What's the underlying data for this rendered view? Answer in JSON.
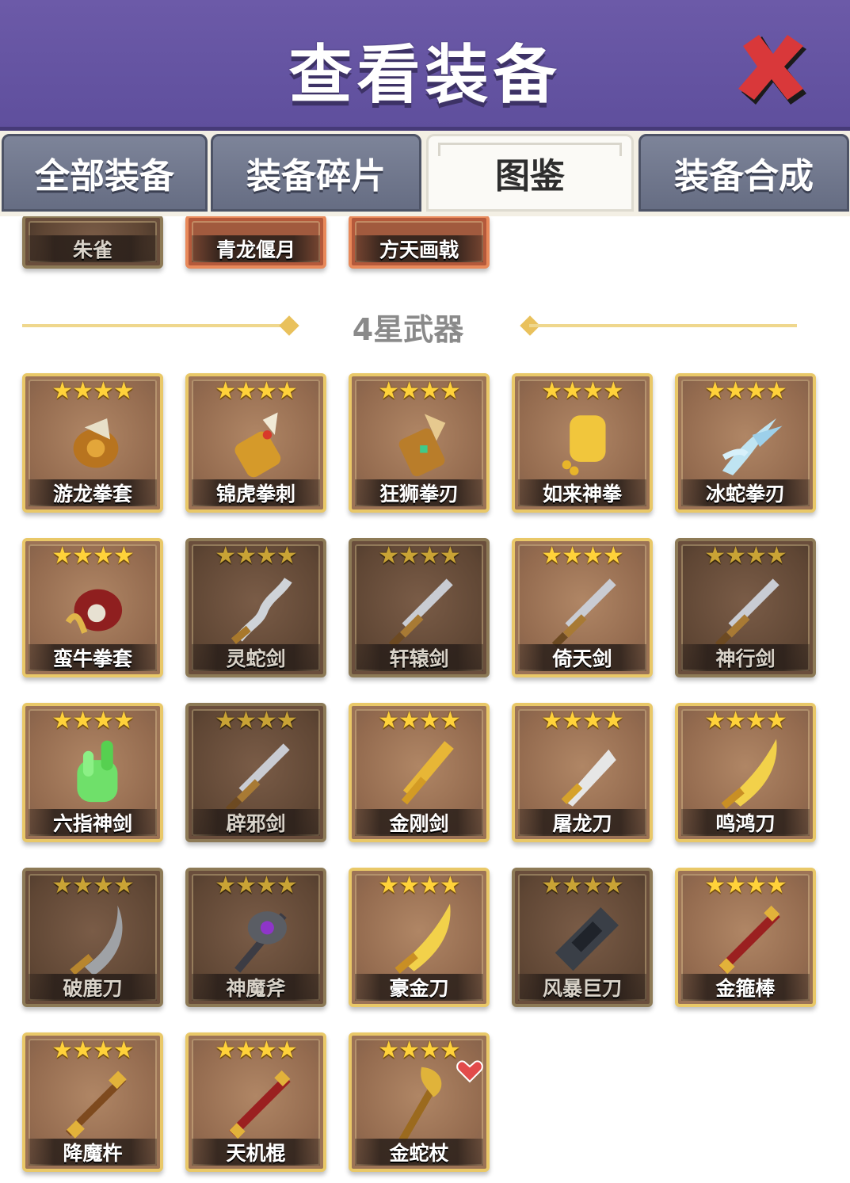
{
  "header": {
    "title": "查看装备",
    "close_icon": "close-x-icon"
  },
  "tabs": [
    {
      "label": "全部装备",
      "active": false
    },
    {
      "label": "装备碎片",
      "active": false
    },
    {
      "label": "图鉴",
      "active": true
    },
    {
      "label": "装备合成",
      "active": false
    }
  ],
  "top_row": [
    {
      "name": "朱雀"
    },
    {
      "name": "青龙偃月"
    },
    {
      "name": "方天画戟"
    }
  ],
  "section": {
    "title": "4星武器"
  },
  "stars_text": "★★★★",
  "items": [
    {
      "name": "游龙拳套",
      "icon": "gauntlet-icon",
      "owned": true
    },
    {
      "name": "锦虎拳刺",
      "icon": "claw-gauntlet-icon",
      "owned": true
    },
    {
      "name": "狂狮拳刃",
      "icon": "lion-gauntlet-icon",
      "owned": true
    },
    {
      "name": "如来神拳",
      "icon": "golden-fist-icon",
      "owned": true
    },
    {
      "name": "冰蛇拳刃",
      "icon": "ice-claw-icon",
      "owned": true
    },
    {
      "name": "蛮牛拳套",
      "icon": "bull-gauntlet-icon",
      "owned": true
    },
    {
      "name": "灵蛇剑",
      "icon": "serpent-sword-icon",
      "owned": false
    },
    {
      "name": "轩辕剑",
      "icon": "sword-icon",
      "owned": false
    },
    {
      "name": "倚天剑",
      "icon": "sword-icon",
      "owned": true
    },
    {
      "name": "神行剑",
      "icon": "sword-icon",
      "owned": false
    },
    {
      "name": "六指神剑",
      "icon": "jade-hand-icon",
      "owned": true
    },
    {
      "name": "辟邪剑",
      "icon": "sword-icon",
      "owned": false
    },
    {
      "name": "金刚剑",
      "icon": "golden-sword-icon",
      "owned": true
    },
    {
      "name": "屠龙刀",
      "icon": "broadsword-icon",
      "owned": true
    },
    {
      "name": "鸣鸿刀",
      "icon": "golden-blade-icon",
      "owned": true
    },
    {
      "name": "破鹿刀",
      "icon": "curved-blade-icon",
      "owned": false
    },
    {
      "name": "神魔斧",
      "icon": "axe-icon",
      "owned": false
    },
    {
      "name": "豪金刀",
      "icon": "golden-blade-icon",
      "owned": true
    },
    {
      "name": "风暴巨刀",
      "icon": "great-blade-icon",
      "owned": false
    },
    {
      "name": "金箍棒",
      "icon": "staff-icon",
      "owned": true
    },
    {
      "name": "降魔杵",
      "icon": "pestle-icon",
      "owned": true
    },
    {
      "name": "天机棍",
      "icon": "staff-icon",
      "owned": true
    },
    {
      "name": "金蛇杖",
      "icon": "snake-staff-icon",
      "owned": true
    }
  ],
  "colors": {
    "header_bg": "#6c5aa8",
    "tab_bg": "#717890",
    "card_border": "#e9c868",
    "card_bg": "#9c7356",
    "star": "#ffd23a",
    "section_line": "#efd78d"
  }
}
